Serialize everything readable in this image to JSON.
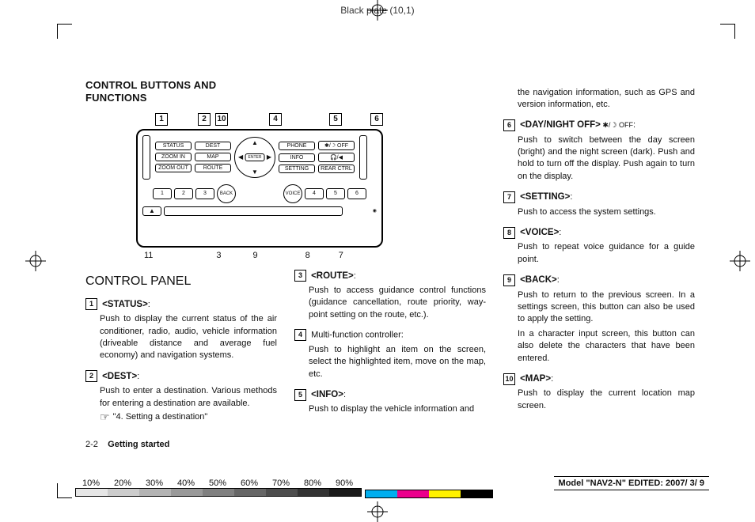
{
  "plate_label": "Black plate (10,1)",
  "title_l1": "CONTROL BUTTONS AND",
  "title_l2": "FUNCTIONS",
  "callout_top": {
    "c1": "1",
    "c2": "2",
    "c10": "10",
    "c4": "4",
    "c5": "5",
    "c6": "6"
  },
  "callout_bottom": {
    "c11": "11",
    "c3": "3",
    "c9": "9",
    "c8": "8",
    "c7": "7"
  },
  "panel": {
    "status": "STATUS",
    "dest": "DEST",
    "phone": "PHONE",
    "off": "✱/☽ OFF",
    "zoomin": "ZOOM IN",
    "map": "MAP",
    "info": "INFO",
    "audio": "🎧/◀",
    "zoomout": "ZOOM OUT",
    "route": "ROUTE",
    "setting": "SETTING",
    "rear": "REAR CTRL",
    "enter": "ENTER",
    "back": "BACK",
    "voice": "VOICE",
    "p1": "1",
    "p2": "2",
    "p3": "3",
    "p4": "4",
    "p5": "5",
    "p6": "6",
    "eject": "▲"
  },
  "cp_heading": "CONTROL PANEL",
  "items": {
    "i1": {
      "num": "1",
      "label": "<STATUS>",
      "colon": ":",
      "desc": "Push to display the current status of the air conditioner, radio, audio, vehicle information (driveable distance and average fuel economy) and navigation systems."
    },
    "i2": {
      "num": "2",
      "label": "<DEST>",
      "colon": ":",
      "desc": "Push to enter a destination. Various methods for entering a destination are available.",
      "ref": "\"4. Setting a destination\""
    },
    "i3": {
      "num": "3",
      "label": "<ROUTE>",
      "colon": ":",
      "desc": "Push to access guidance control functions (guidance cancellation, route priority, way-point setting on the route, etc.)."
    },
    "i4": {
      "num": "4",
      "label": "Multi-function controller:",
      "desc": "Push to highlight an item on the screen, select the highlighted item, move on the map, etc."
    },
    "i5": {
      "num": "5",
      "label": "<INFO>",
      "colon": ":",
      "desc": "Push to display the vehicle information and"
    },
    "i5b": {
      "desc": "the navigation information, such as GPS and version information, etc."
    },
    "i6": {
      "num": "6",
      "label": "<DAY/NIGHT OFF>",
      "extra": " ✱/☽ OFF",
      "colon": ":",
      "desc": "Push to switch between the day screen (bright) and the night screen (dark). Push and hold to turn off the display. Push again to turn on the display."
    },
    "i7": {
      "num": "7",
      "label": "<SETTING>",
      "colon": ":",
      "desc": "Push to access the system settings."
    },
    "i8": {
      "num": "8",
      "label": "<VOICE>",
      "colon": ":",
      "desc": "Push to repeat voice guidance for a guide point."
    },
    "i9": {
      "num": "9",
      "label": "<BACK>",
      "colon": ":",
      "desc": "Push to return to the previous screen. In a settings screen, this button can also be used to apply the setting.",
      "desc2": "In a character input screen, this button can also delete the characters that have been entered."
    },
    "i10": {
      "num": "10",
      "label": "<MAP>",
      "colon": ":",
      "desc": "Push to display the current location map screen."
    }
  },
  "footer_num": "2-2",
  "footer_txt": "Getting started",
  "model_line": "Model \"NAV2-N\"  EDITED:  2007/ 3/ 9",
  "percents": {
    "p1": "10%",
    "p2": "20%",
    "p3": "30%",
    "p4": "40%",
    "p5": "50%",
    "p6": "60%",
    "p7": "70%",
    "p8": "80%",
    "p9": "90%"
  },
  "bar_colors": [
    "#00aeef",
    "#ec008c",
    "#fff200",
    "#000000"
  ]
}
